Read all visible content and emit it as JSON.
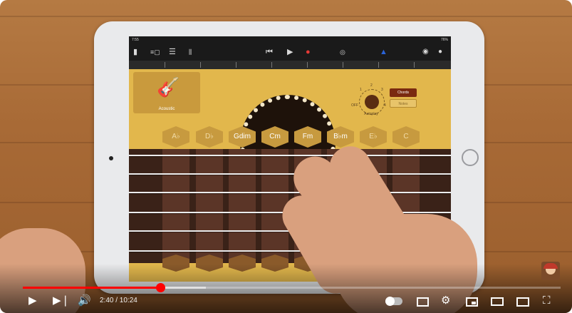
{
  "player": {
    "current_time": "2:40",
    "duration": "10:24",
    "time_display": "2:40 / 10:24",
    "progress_fraction": 0.256,
    "buffered_fraction": 0.34,
    "accent_color": "#ff0000"
  },
  "garageband": {
    "status_time": "7:55",
    "status_right": "76%",
    "instrument_label": "Acoustic",
    "knob_label": "Autoplay",
    "knob_numbers": [
      "OFF",
      "1",
      "2",
      "3",
      "4"
    ],
    "chords_button": "Chords",
    "notes_button": "Notes",
    "chords": [
      "A♭",
      "D♭",
      "Gdim",
      "Cm",
      "Fm",
      "B♭m",
      "E♭",
      "C"
    ]
  },
  "controls": {
    "play_icon": "play-icon",
    "next_icon": "next-icon",
    "volume_icon": "volume-icon",
    "autoplay_icon": "autoplay-toggle",
    "subtitles_icon": "subtitles-icon",
    "settings_icon": "gear-icon",
    "miniplayer_icon": "miniplayer-icon",
    "theater_icon": "theater-icon",
    "cast_icon": "cast-icon",
    "fullscreen_icon": "fullscreen-icon"
  }
}
